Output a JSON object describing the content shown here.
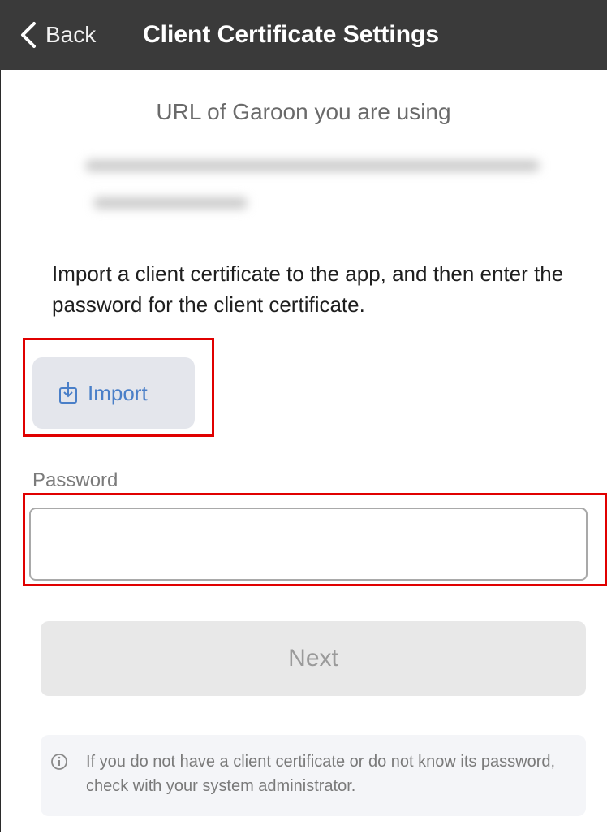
{
  "navbar": {
    "back_label": "Back",
    "title": "Client Certificate Settings"
  },
  "url_section": {
    "title": "URL of Garoon you are using"
  },
  "instructions": "Import a client certificate to the app, and then enter the password for the client certificate.",
  "import_button": {
    "label": "Import",
    "icon": "import-icon"
  },
  "password": {
    "label": "Password",
    "value": "",
    "placeholder": ""
  },
  "next_button": {
    "label": "Next"
  },
  "info": {
    "icon": "info-icon",
    "text": "If you do not have a client certificate or do not know its password, check with your system administrator."
  },
  "colors": {
    "navbar_bg": "#3a3a3a",
    "accent_blue": "#4a7fc8",
    "highlight_red": "#e00000",
    "disabled_button_bg": "#e8e8e8"
  }
}
